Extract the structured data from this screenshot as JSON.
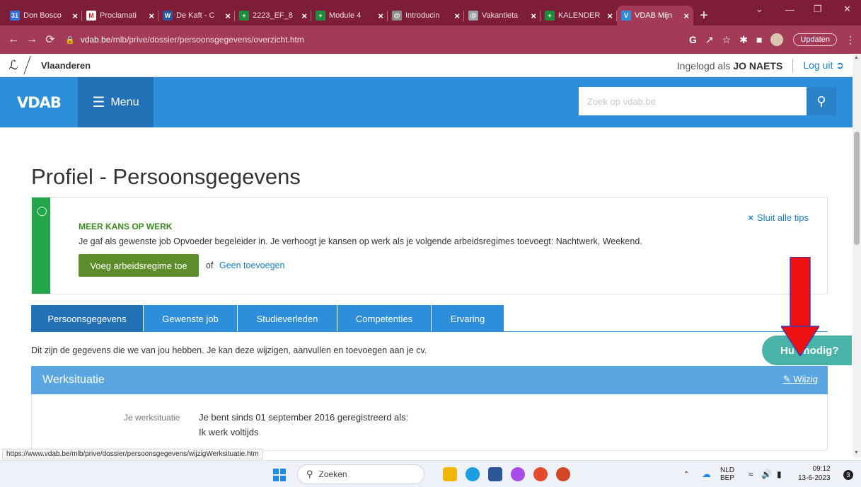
{
  "browser": {
    "tabs": [
      {
        "title": "Don Bosco",
        "favicon_color": "#2e6fd8",
        "favicon_glyph": "31"
      },
      {
        "title": "Proclamati",
        "favicon_color": "#ffffff",
        "favicon_glyph": "M"
      },
      {
        "title": "De Kaft - C",
        "favicon_color": "#2b5797",
        "favicon_glyph": "W"
      },
      {
        "title": "2223_EF_8",
        "favicon_color": "#1e8e3e",
        "favicon_glyph": "+"
      },
      {
        "title": "Module 4",
        "favicon_color": "#1e8e3e",
        "favicon_glyph": "+"
      },
      {
        "title": "Introducin",
        "favicon_color": "#8b8b8b",
        "favicon_glyph": "@"
      },
      {
        "title": "Vakantieta",
        "favicon_color": "#9aa0a6",
        "favicon_glyph": "@"
      },
      {
        "title": "KALENDER",
        "favicon_color": "#1e8e3e",
        "favicon_glyph": "+"
      },
      {
        "title": "VDAB Mijn",
        "favicon_color": "#2d8ed9",
        "favicon_glyph": "V"
      }
    ],
    "url_domain": "vdab.be",
    "url_path": "/mlb/prive/dossier/persoonsgegevens/overzicht.htm",
    "update_label": "Updaten",
    "status_url": "https://www.vdab.be/mlb/prive/dossier/persoonsgegevens/wijzigWerksituatie.htm"
  },
  "vlaanderen": {
    "name": "Vlaanderen",
    "logged_in_prefix": "Ingelogd als",
    "user": "JO NAETS",
    "logout": "Log uit"
  },
  "header": {
    "logo": "VDAB",
    "menu": "Menu",
    "search_placeholder": "Zoek op vdab.be"
  },
  "page": {
    "title": "Profiel - Persoonsgegevens",
    "tip": {
      "heading": "MEER KANS OP WERK",
      "text": "Je gaf als gewenste job Opvoeder begeleider in. Je verhoogt je kansen op werk als je volgende arbeidsregimes toevoegt: Nachtwerk, Weekend.",
      "cta": "Voeg arbeidsregime toe",
      "or": "of",
      "skip": "Geen toevoegen",
      "close_all": "Sluit alle tips"
    },
    "tabs": [
      {
        "label": "Persoonsgegevens",
        "active": true
      },
      {
        "label": "Gewenste job",
        "active": false
      },
      {
        "label": "Studieverleden",
        "active": false
      },
      {
        "label": "Competenties",
        "active": false
      },
      {
        "label": "Ervaring",
        "active": false
      }
    ],
    "intro": "Dit zijn de gegevens die we van jou hebben. Je kan deze wijzigen, aanvullen en toevoegen aan je cv.",
    "section": {
      "title": "Werksituatie",
      "edit": "Wijzig",
      "field_label": "Je werksituatie",
      "value_line1": "Je bent sinds 01 september 2016 geregistreerd als:",
      "value_line2": "Ik werk voltijds"
    },
    "help": "Hulp nodig?",
    "help_visible": "Hu   nodig?"
  },
  "taskbar": {
    "search": "Zoeken",
    "lang": "NLD",
    "lang2": "BEP",
    "time": "09:12",
    "date": "13-6-2023",
    "notifications": "3"
  }
}
